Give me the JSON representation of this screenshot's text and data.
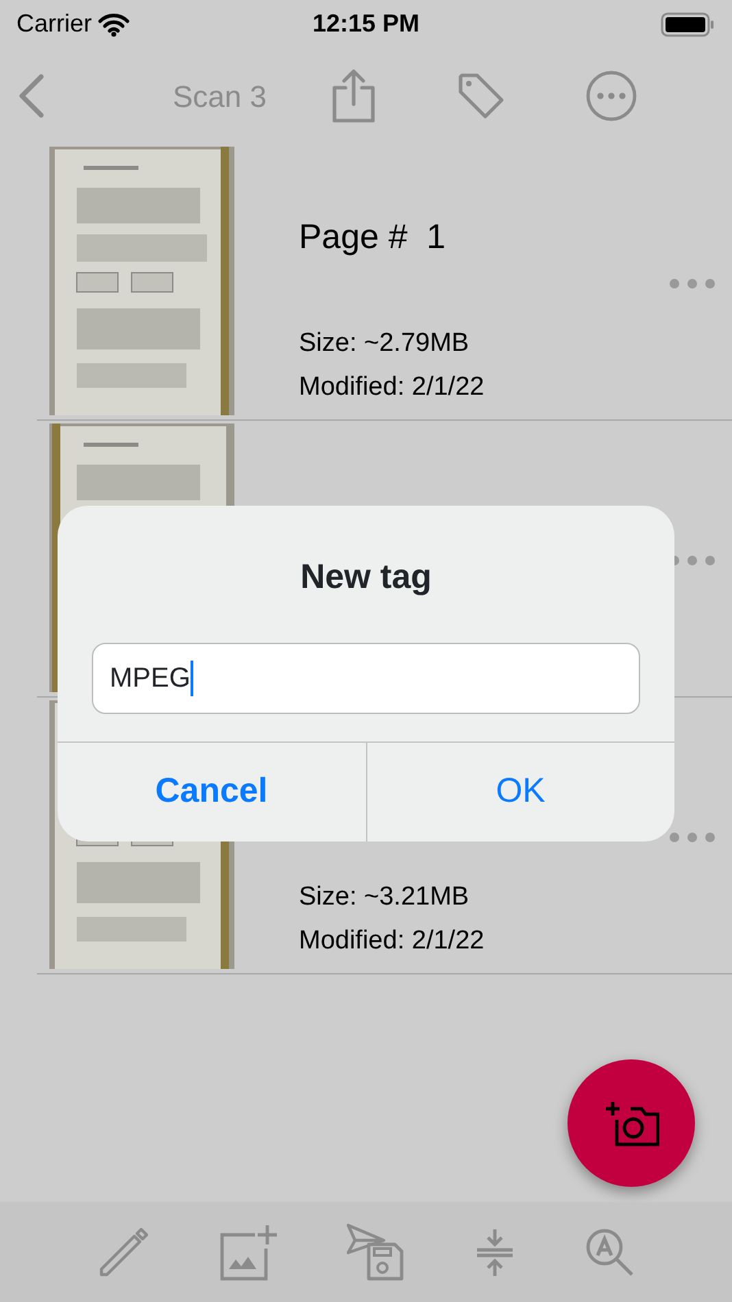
{
  "status_bar": {
    "carrier": "Carrier",
    "time": "12:15 PM"
  },
  "nav_bar": {
    "title": "Scan 3"
  },
  "pages": [
    {
      "kind": "picture",
      "title": "Page #  1",
      "size": "Size: ~2.79MB",
      "modified": "Modified: 2/1/22"
    },
    {
      "kind": "picture"
    },
    {
      "kind": "picture",
      "size": "Size: ~3.21MB",
      "modified": "Modified: 2/1/22"
    }
  ],
  "dialog": {
    "title": "New tag",
    "value": "MPEG",
    "buttons": [
      {
        "label": "Cancel",
        "kind": "cancel"
      },
      {
        "label": "OK",
        "kind": "default"
      }
    ]
  }
}
